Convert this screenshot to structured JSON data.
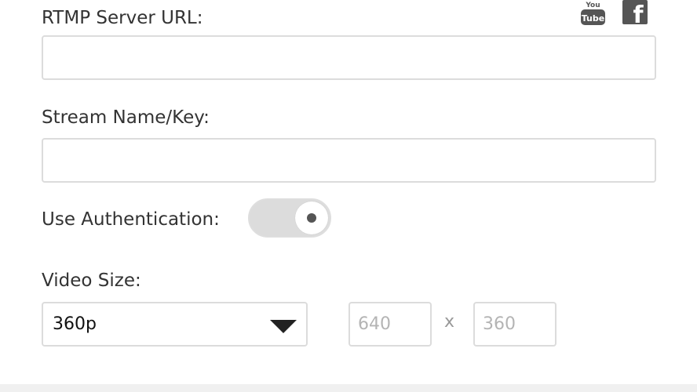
{
  "rtmp": {
    "label": "RTMP Server URL:",
    "value": "",
    "placeholder": ""
  },
  "stream": {
    "label": "Stream Name/Key:",
    "value": "",
    "placeholder": ""
  },
  "auth": {
    "label": "Use Authentication:",
    "enabled": false
  },
  "video": {
    "label": "Video Size:",
    "selected": "360p",
    "width_placeholder": "640",
    "height_placeholder": "360",
    "separator": "x"
  },
  "social": {
    "youtube_icon": "youtube-icon",
    "youtube_text_top": "You",
    "youtube_text_bottom": "Tube",
    "facebook_icon": "facebook-icon",
    "facebook_glyph": "f"
  },
  "colors": {
    "icon": "#555555",
    "border": "#dcdcdc",
    "toggle_track": "#dcdcdc"
  }
}
